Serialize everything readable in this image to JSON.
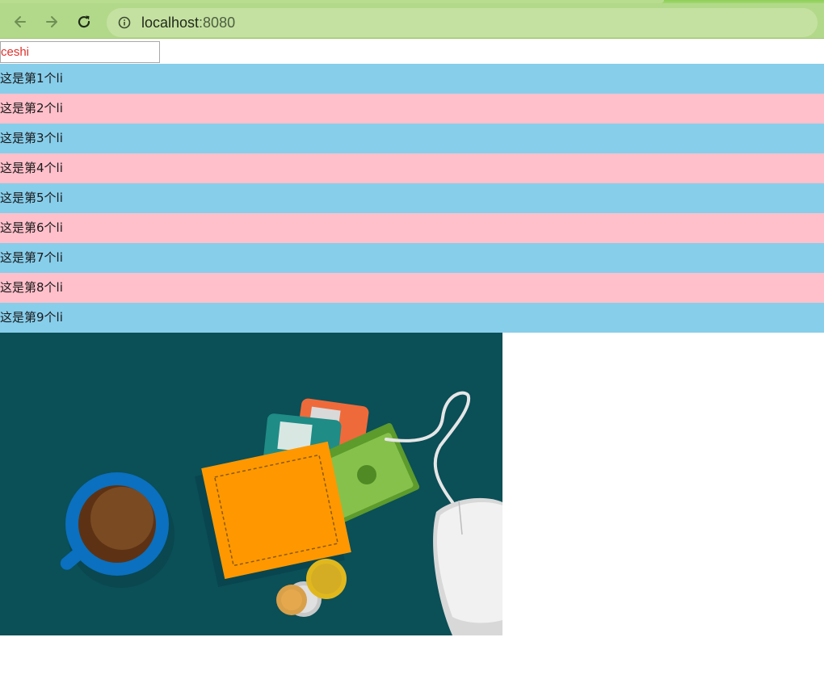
{
  "browser": {
    "url_host": "localhost",
    "url_port": ":8080",
    "icons": {
      "back": "back-arrow-icon",
      "forward": "forward-arrow-icon",
      "reload": "reload-icon",
      "info": "info-icon"
    }
  },
  "page": {
    "input_value": "ceshi",
    "input_color": "#e0312b",
    "list_colors": {
      "odd": "#87ceeb",
      "even": "#ffc0cb"
    },
    "items": [
      "这是第1个li",
      "这是第2个li",
      "这是第3个li",
      "这是第4个li",
      "这是第5个li",
      "这是第6个li",
      "这是第7个li",
      "这是第8个li",
      "这是第9个li"
    ],
    "image_bg": "#0b4f57"
  }
}
